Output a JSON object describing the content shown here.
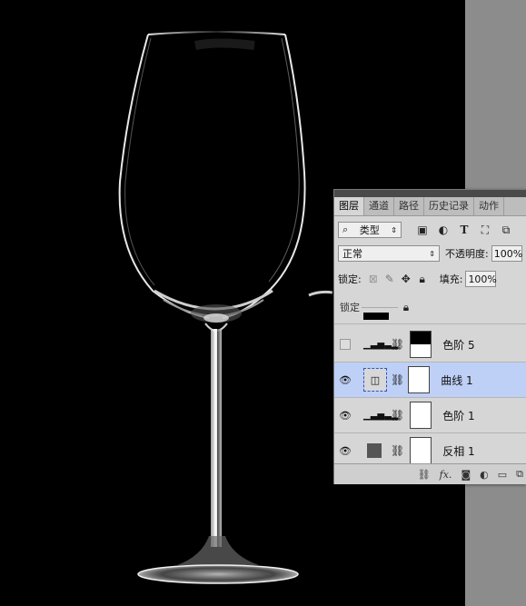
{
  "panel": {
    "tabs": [
      {
        "label": "图层"
      },
      {
        "label": "通道"
      },
      {
        "label": "路径"
      },
      {
        "label": "历史记录"
      },
      {
        "label": "动作"
      }
    ],
    "filter_kind": "类型",
    "filter_icons": [
      "pixel-filter-icon",
      "adjustment-filter-icon",
      "type-filter-icon",
      "shape-filter-icon",
      "smart-object-filter-icon"
    ],
    "blend_mode": "正常",
    "opacity_label": "不透明度:",
    "opacity_value": "100%",
    "lock_label": "锁定:",
    "fill_label": "填充:",
    "fill_value": "100%",
    "drag_ghost_label": "锁定",
    "layers": [
      {
        "name": "色阶 5",
        "visible": false,
        "selected": false
      },
      {
        "name": "曲线 1",
        "visible": true,
        "selected": true
      },
      {
        "name": "色阶 1",
        "visible": true,
        "selected": false
      },
      {
        "name": "反相 1",
        "visible": true,
        "selected": false
      }
    ],
    "footer_icons": [
      "link-layers-icon",
      "fx-icon",
      "add-mask-icon",
      "new-adjustment-icon",
      "new-group-icon",
      "new-layer-icon"
    ],
    "footer_fx_label": "fx."
  },
  "colors": {
    "canvas": "#000000",
    "panel_bg": "#d6d6d6",
    "selected_row": "#bfd0f6",
    "side_bar": "#8c8c8c"
  }
}
